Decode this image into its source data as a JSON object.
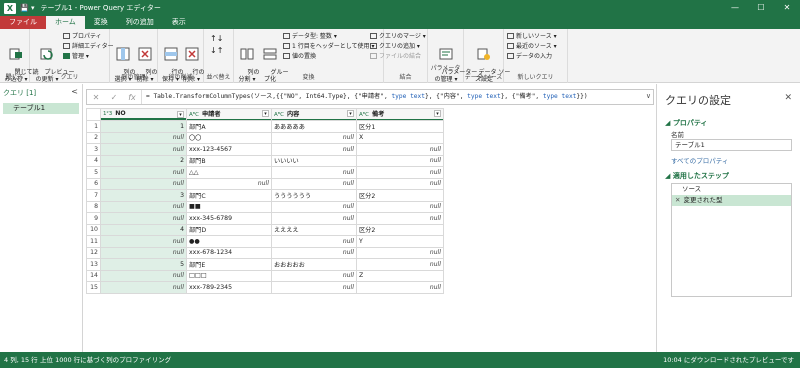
{
  "window": {
    "title": "テーブル1 - Power Query エディター",
    "logo": "X",
    "quick_access": "💾 ▾",
    "minimize": "—",
    "maximize": "☐",
    "close": "✕"
  },
  "tabs": [
    "ファイル",
    "ホーム",
    "変換",
    "列の追加",
    "表示"
  ],
  "ribbon": {
    "groups": {
      "close": "閉じる",
      "query": "クエリ",
      "manage_columns": "列の管理",
      "reduce_rows": "行の削減",
      "sort": "並べ替え",
      "transform": "変換",
      "combine": "結合",
      "parameters": "パラメーター",
      "data_source": "データ ソース",
      "new_query": "新しいクエリ"
    },
    "close_load": "閉じて読\nみ込む ▾",
    "refresh_preview": "プレビュー\nの更新 ▾",
    "properties": "プロパティ",
    "advanced_editor": "詳細エディター",
    "manage": "管理 ▾",
    "choose_columns": "列の\n選択 ▾",
    "remove_columns": "列の\n削除 ▾",
    "keep_rows": "行の\n保持 ▾",
    "remove_rows": "行の\n削除 ▾",
    "split_column": "列の\n分割 ▾",
    "group_by": "グルー\nプ化",
    "data_type": "データ型: 整数 ▾",
    "use_first_row": "1 行目をヘッダーとして使用 ▾",
    "replace_values": "値の置換",
    "merge_queries": "クエリのマージ ▾",
    "append_queries": "クエリの追加 ▾",
    "combine_files": "ファイルの結合",
    "manage_parameters": "パラメーター\nの管理 ▾",
    "data_source_settings": "データ ソー\nス設定",
    "new_source": "新しいソース ▾",
    "recent_sources": "最近のソース ▾",
    "enter_data": "データの入力"
  },
  "left_pane": {
    "header": "クエリ [1]",
    "collapse": "<",
    "query_item": "テーブル1"
  },
  "formula_bar": {
    "cancel": "✕",
    "confirm": "✓",
    "fx": "fx",
    "expand": "∨",
    "text_prefix": "= Table.TransformColumnTypes(ソース,{{\"NO\", Int64.Type}, {\"申請者\", ",
    "kw1": "type text",
    "text_mid1": "}, {\"内容\", ",
    "kw2": "type text",
    "text_mid2": "}, {\"備考\", ",
    "kw3": "type text",
    "text_suffix": "}})"
  },
  "grid": {
    "columns": [
      {
        "type": "1²3",
        "name": "NO"
      },
      {
        "type": "AᴮC",
        "name": "申請者"
      },
      {
        "type": "AᴮC",
        "name": "内容"
      },
      {
        "type": "AᴮC",
        "name": "備考"
      }
    ],
    "rows": [
      [
        "1",
        "1",
        "部門A",
        "あああああ",
        "区分1"
      ],
      [
        "2",
        "null",
        "〇〇",
        "null",
        "X"
      ],
      [
        "3",
        "null",
        "xxx-123-4567",
        "null",
        "null"
      ],
      [
        "4",
        "2",
        "部門B",
        "いいいい",
        "null"
      ],
      [
        "5",
        "null",
        "△△",
        "null",
        "null"
      ],
      [
        "6",
        "null",
        "null",
        "null",
        "null"
      ],
      [
        "7",
        "3",
        "部門C",
        "うううううう",
        "区分2"
      ],
      [
        "8",
        "null",
        "■■",
        "null",
        "null"
      ],
      [
        "9",
        "null",
        "xxx-345-6789",
        "null",
        "null"
      ],
      [
        "10",
        "4",
        "部門D",
        "ええええ",
        "区分2"
      ],
      [
        "11",
        "null",
        "●●",
        "null",
        "Y"
      ],
      [
        "12",
        "null",
        "xxx-678-1234",
        "null",
        "null"
      ],
      [
        "13",
        "5",
        "部門E",
        "おおおおお",
        "null"
      ],
      [
        "14",
        "null",
        "□□□",
        "null",
        "Z"
      ],
      [
        "15",
        "null",
        "xxx-789-2345",
        "null",
        "null"
      ]
    ]
  },
  "settings": {
    "title": "クエリの設定",
    "close": "✕",
    "properties_header": "◢ プロパティ",
    "name_label": "名前",
    "name_value": "テーブル1",
    "all_properties": "すべてのプロパティ",
    "applied_steps_header": "◢ 適用したステップ",
    "steps": [
      "ソース",
      "変更された型"
    ],
    "step_delete": "✕"
  },
  "status_bar": {
    "counts": "4 列, 15 行",
    "profiling": "上位 1000 行に基づく列のプロファイリング",
    "download": "10:04 にダウンロードされたプレビューです"
  },
  "colors": {
    "accent": "#217346",
    "file_tab": "#c23a3a",
    "selection": "#c9e6d3"
  }
}
